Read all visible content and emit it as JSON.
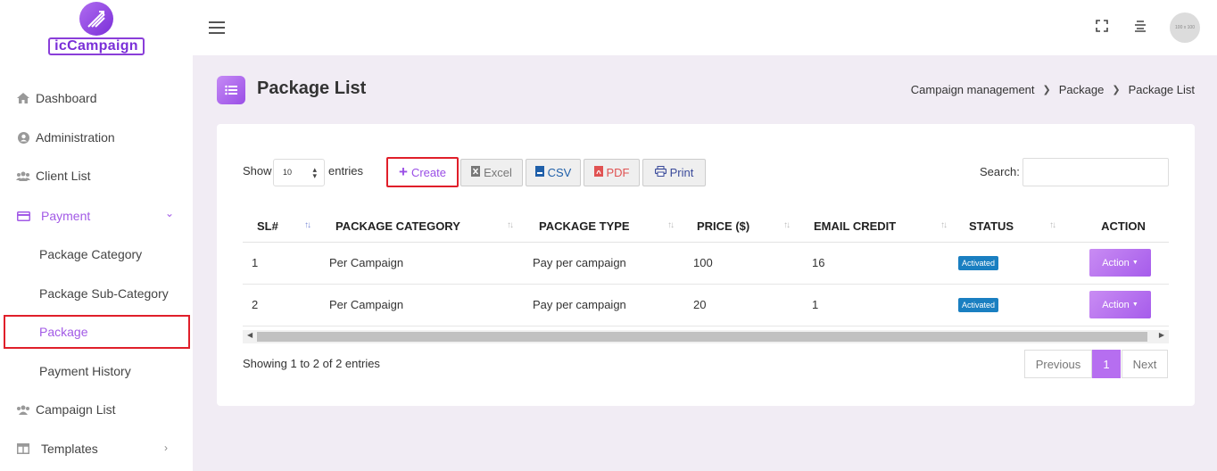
{
  "app": {
    "logo_text": "icCampaign"
  },
  "sidebar": {
    "items": [
      {
        "label": "Dashboard"
      },
      {
        "label": "Administration"
      },
      {
        "label": "Client List"
      },
      {
        "label": "Payment"
      },
      {
        "label": "Campaign List"
      },
      {
        "label": "Templates"
      }
    ],
    "payment_sub": [
      {
        "label": "Package Category"
      },
      {
        "label": "Package Sub-Category"
      },
      {
        "label": "Package"
      },
      {
        "label": "Payment History"
      }
    ]
  },
  "topbar": {
    "avatar_text": "100 x 100"
  },
  "page": {
    "title": "Package List",
    "breadcrumb": [
      "Campaign management",
      "Package",
      "Package List"
    ]
  },
  "controls": {
    "show_label": "Show",
    "entries_value": "10",
    "entries_label": "entries",
    "create": "Create",
    "excel": "Excel",
    "csv": "CSV",
    "pdf": "PDF",
    "print": "Print",
    "search_label": "Search:"
  },
  "table": {
    "headers": [
      "SL#",
      "PACKAGE CATEGORY",
      "PACKAGE TYPE",
      "PRICE ($)",
      "EMAIL CREDIT",
      "STATUS",
      "ACTION"
    ],
    "rows": [
      {
        "sl": "1",
        "category": "Per Campaign",
        "type": "Pay per campaign",
        "price": "100",
        "credit": "16",
        "status": "Activated",
        "action": "Action"
      },
      {
        "sl": "2",
        "category": "Per Campaign",
        "type": "Pay per campaign",
        "price": "20",
        "credit": "1",
        "status": "Activated",
        "action": "Action"
      }
    ]
  },
  "footer": {
    "showing": "Showing 1 to 2 of 2 entries",
    "previous": "Previous",
    "page": "1",
    "next": "Next"
  }
}
